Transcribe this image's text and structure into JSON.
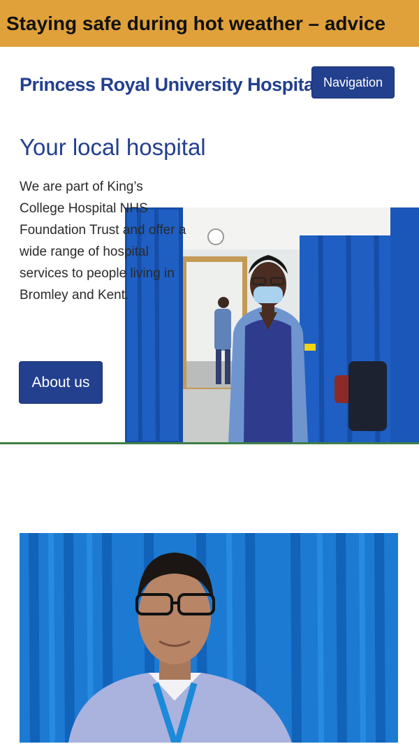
{
  "alert": {
    "text": "Staying safe during hot weather – advice"
  },
  "header": {
    "site_title": "Princess Royal University Hospital",
    "nav_label": "Navigation"
  },
  "main": {
    "heading": "Your local hospital",
    "intro": "We are part of King’s College Hospital NHS Foundation Trust and offer a wide range of hospital services to people living in Bromley and Kent.",
    "about_label": "About us"
  },
  "colors": {
    "brand_blue": "#23408e",
    "banner_amber": "#e0a13a",
    "divider_green": "#3f7f46"
  }
}
